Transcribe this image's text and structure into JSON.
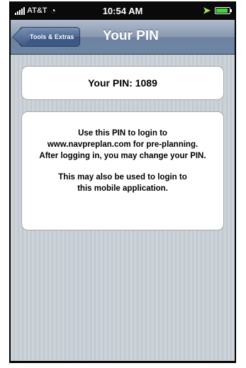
{
  "status_bar": {
    "carrier": "AT&T",
    "time": "10:54 AM",
    "battery_level": 0.85
  },
  "nav_bar": {
    "back_label": "Tools & Extras",
    "title": "Your PIN"
  },
  "pin_card": {
    "text": "Your PIN: 1089"
  },
  "info_card": {
    "paragraph1": [
      "Use this PIN to login to",
      "www.navpreplan.com for pre-planning.",
      "After logging in, you may change your PIN."
    ],
    "paragraph2": [
      "This may also be used to login to",
      "this mobile application."
    ]
  },
  "icons": [
    "signal-icon",
    "wifi-icon",
    "location-icon",
    "battery-icon"
  ],
  "colors": {
    "nav_bar": "#6d84a2",
    "background": "#c5ccd4",
    "status_bar": "#0a0a0a"
  }
}
